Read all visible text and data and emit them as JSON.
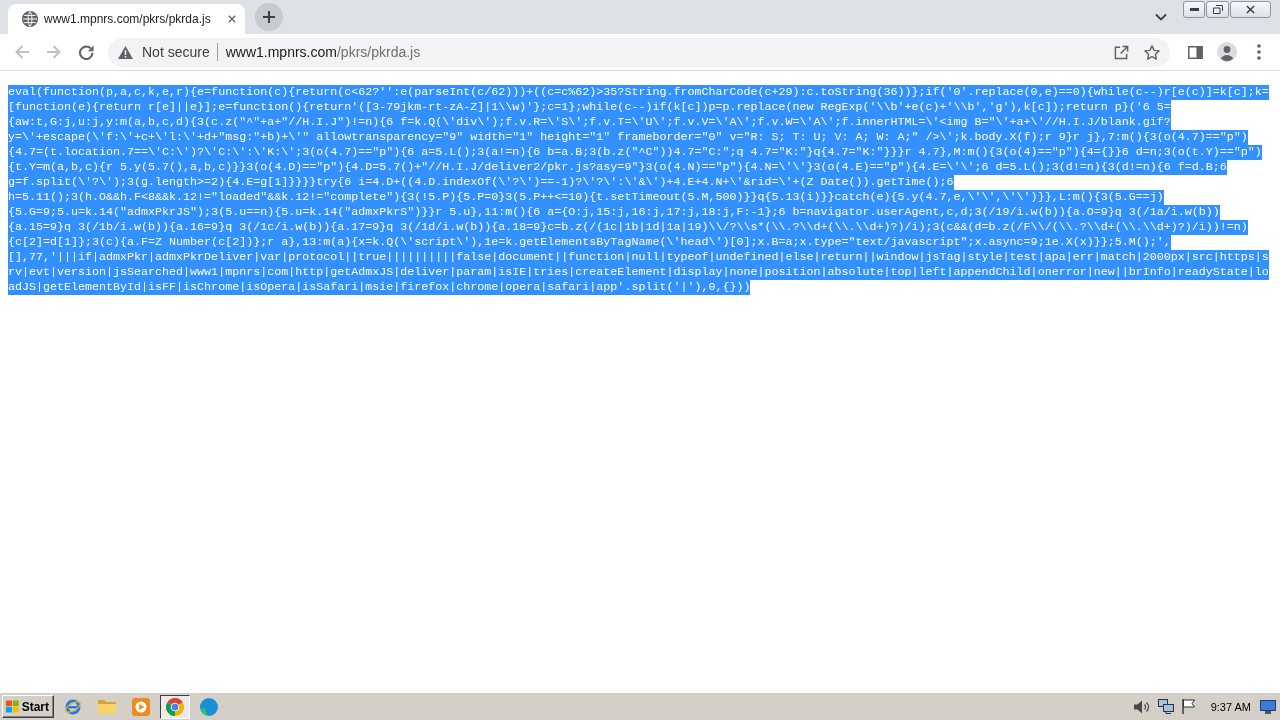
{
  "tabs": [
    {
      "title": "www1.mpnrs.com/pkrs/pkrda.js",
      "selected": true
    }
  ],
  "toolbar": {
    "back": {
      "disabled": true
    },
    "forward": {
      "disabled": true
    },
    "security": "Not secure",
    "url": {
      "host": "www1.mpnrs.com",
      "path": "/pkrs/pkrda.js"
    }
  },
  "code": {
    "selected": true,
    "lines": [
      "eval(function(p,a,c,k,e,r){e=function(c){return(c<62?'':e(parseInt(c/62)))+((c=c%62)>35?String.fromCharCode(c+29):c.toString(36))};if('0'.replace(0,e)==0){while(c--)r[e(c)]=k[c];k=",
      "[function(e){return r[e]||e}];e=function(){return'([3-79jkm-rt-zA-Z]|1\\\\w)'};c=1};while(c--)if(k[c])p=p.replace(new RegExp('\\\\b'+e(c)+'\\\\b','g'),k[c]);return p}('6 5=",
      "{aw:t,G:j,u:j,y:m(a,b,c,d){3(c.z(\"^\"+a+\"//H.I.J\")!=n){6 f=k.Q(\\'div\\');f.v.R=\\'S\\';f.v.T=\\'U\\';f.v.V=\\'A\\';f.v.W=\\'A\\';f.innerHTML=\\'<img B=\"\\'+a+\\'//H.I.J/blank.gif?",
      "y=\\'+escape(\\'f:\\'+c+\\'l:\\'+d+\"msg:\"+b)+\\'\" allowtransparency=\"9\" width=\"1\" height=\"1\" frameborder=\"0\" v=\"R: S; T: U; V: A; W: A;\" />\\';k.body.X(f);r 9}r j},7:m(){3(o(4.7)==\"p\")",
      "{4.7=(t.location.7==\\'C:\\')?\\'C:\\':\\'K:\\';3(o(4.7)==\"p\"){6 a=5.L();3(a!=n){6 b=a.B;3(b.z(\"^C\"))4.7=\"C:\";q 4.7=\"K:\"}q{4.7=\"K:\"}}}r 4.7},M:m(){3(o(4)==\"p\"){4={}}6 d=n;3(o(t.Y)==\"p\")",
      "{t.Y=m(a,b,c){r 5.y(5.7(),a,b,c)}}3(o(4.D)==\"p\"){4.D=5.7()+\"//H.I.J/deliver2/pkr.js?asy=9\"}3(o(4.N)==\"p\"){4.N=\\'\\'}3(o(4.E)==\"p\"){4.E=\\'\\';6 d=5.L();3(d!=n){3(d!=n){6 f=d.B;6",
      "g=f.split(\\'?\\');3(g.length>=2){4.E=g[1]}}}}try{6 i=4.D+((4.D.indexOf(\\'?\\')==-1)?\\'?\\':\\'&\\')+4.E+4.N+\\'&rid=\\'+(Z Date()).getTime();6",
      "h=5.11();3(h.O&&h.F<8&&k.12!=\"loaded\"&&k.12!=\"complete\"){3(!5.P){5.P=0}3(5.P++<=10){t.setTimeout(5.M,500)}}q{5.13(i)}}catch(e){5.y(4.7,e,\\'\\',\\'\\')}},L:m(){3(5.G==j)",
      "{5.G=9;5.u=k.14(\"admxPkrJS\");3(5.u==n){5.u=k.14(\"admxPkrS\")}}r 5.u},11:m(){6 a={O:j,15:j,16:j,17:j,18:j,F:-1};6 b=navigator.userAgent,c,d;3(/19/i.w(b)){a.O=9}q 3(/1a/i.w(b))",
      "{a.15=9}q 3(/1b/i.w(b)){a.16=9}q 3(/1c/i.w(b)){a.17=9}q 3(/1d/i.w(b)){a.18=9}c=b.z(/(1c|1b|1d|1a|19)\\\\/?\\\\s*(\\\\.?\\\\d+(\\\\.\\\\d+)?)/i);3(c&&(d=b.z(/F\\\\/(\\\\.?\\\\d+(\\\\.\\\\d+)?)/i))!=n)",
      "{c[2]=d[1]};3(c){a.F=Z Number(c[2])};r a},13:m(a){x=k.Q(\\'script\\'),1e=k.getElementsByTagName(\\'head\\')[0];x.B=a;x.type=\"text/javascript\";x.async=9;1e.X(x)}};5.M();',",
      "[],77,'|||if|admxPkr|admxPkrDeliver|var|protocol||true||||||||||false|document||function|null|typeof|undefined|else|return||window|jsTag|style|test|apa|err|match|2000px|src|https|s",
      "rv|evt|version|jsSearched|www1|mpnrs|com|http|getAdmxJS|deliver|param|isIE|tries|createElement|display|none|position|absolute|top|left|appendChild|onerror|new||brInfo|readyState|lo",
      "adJS|getElementById|isFF|isChrome|isOpera|isSafari|msie|firefox|chrome|opera|safari|app'.split('|'),0,{}))"
    ]
  },
  "taskbar": {
    "start": "Start",
    "apps": [
      {
        "kind": "orbit",
        "selected": false
      },
      {
        "kind": "folder",
        "selected": false
      },
      {
        "kind": "player",
        "selected": false
      },
      {
        "kind": "ring",
        "selected": true
      },
      {
        "kind": "wave",
        "selected": false
      }
    ],
    "clock": "9:37 AM"
  }
}
